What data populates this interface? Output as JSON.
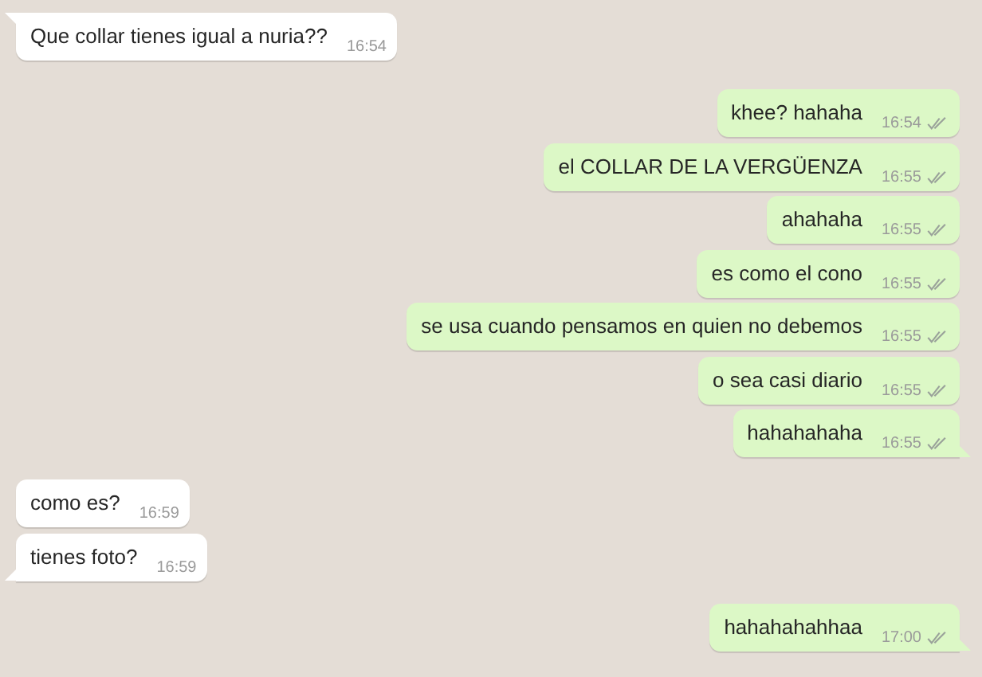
{
  "groups": [
    {
      "outgoing": false,
      "messages": [
        {
          "text": "Que collar tienes igual a nuria??",
          "time": "16:54",
          "tail": true
        }
      ]
    },
    {
      "outgoing": true,
      "messages": [
        {
          "text": "khee? hahaha",
          "time": "16:54",
          "delivered": true,
          "tail": false
        },
        {
          "text": "el COLLAR DE LA VERGÜENZA",
          "time": "16:55",
          "delivered": true,
          "tail": false
        },
        {
          "text": "ahahaha",
          "time": "16:55",
          "delivered": true,
          "tail": false
        },
        {
          "text": "es como el cono",
          "time": "16:55",
          "delivered": true,
          "tail": false
        },
        {
          "text": "se usa cuando pensamos en quien no debemos",
          "time": "16:55",
          "delivered": true,
          "tail": false
        },
        {
          "text": "o sea casi diario",
          "time": "16:55",
          "delivered": true,
          "tail": false
        },
        {
          "text": "hahahahaha",
          "time": "16:55",
          "delivered": true,
          "tail": true
        }
      ]
    },
    {
      "outgoing": false,
      "messages": [
        {
          "text": "como es?",
          "time": "16:59",
          "tail": false
        },
        {
          "text": "tienes foto?",
          "time": "16:59",
          "tail": true
        }
      ]
    },
    {
      "outgoing": true,
      "messages": [
        {
          "text": "hahahahahhaa",
          "time": "17:00",
          "delivered": true,
          "tail": true
        }
      ]
    }
  ]
}
